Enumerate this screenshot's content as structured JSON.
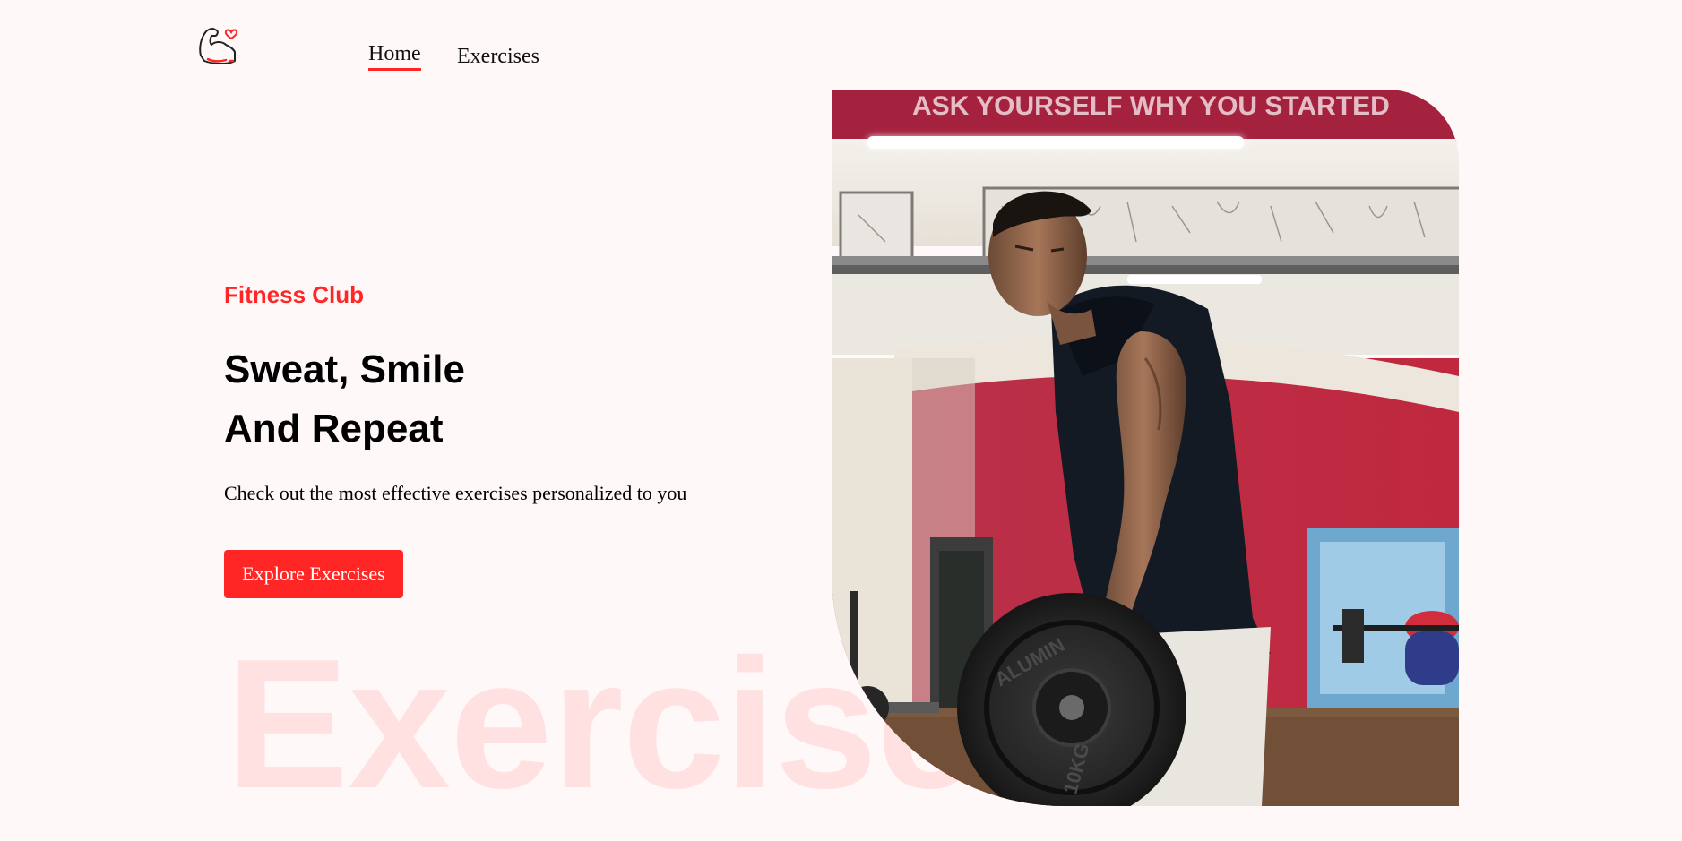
{
  "nav": {
    "logo_icon": "flexed-arm-heart-icon",
    "links": [
      {
        "label": "Home",
        "active": true
      },
      {
        "label": "Exercises",
        "active": false
      }
    ]
  },
  "hero": {
    "label": "Fitness Club",
    "title_line1": "Sweat, Smile",
    "title_line2": "And Repeat",
    "subtitle": "Check out the most effective exercises personalized to you",
    "cta_label": "Explore Exercises",
    "background_word": "Exercise",
    "image_description": "gym-photo-man-lifting-barbell",
    "gym_banner_text": "ASK YOURSELF WHY YOU STARTED"
  },
  "colors": {
    "accent": "#ff2625",
    "background": "#fff8f8",
    "text": "#000000"
  }
}
